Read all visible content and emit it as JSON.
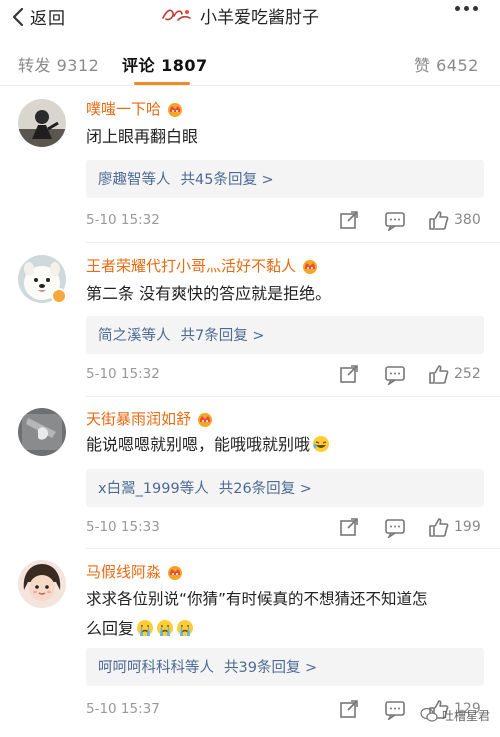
{
  "nav": {
    "back_label": "返回",
    "title": "小羊爱吃酱肘子"
  },
  "tabs": [
    {
      "label": "转发 9312",
      "active": false
    },
    {
      "label": "评论 1807",
      "active": true
    },
    {
      "label": "赞 6452",
      "active": false
    }
  ],
  "colors": {
    "accent": "#f28a1f",
    "username": "#e86b13",
    "reply_link": "#4d6a94",
    "meta_gray": "#999999"
  },
  "comments": [
    {
      "user": "噗嗤一下哈",
      "text": "闭上眼再翻白眼",
      "reply_users": "廖趣智等人",
      "reply_count": "共45条回复 >",
      "time": "5-10 15:32",
      "likes": "380"
    },
    {
      "user": "王者荣耀代打小哥灬活好不黏人",
      "text": "第二条 没有爽快的答应就是拒绝。",
      "reply_users": "简之溪等人",
      "reply_count": "共7条回复 >",
      "time": "5-10 15:32",
      "likes": "252"
    },
    {
      "user": "天街暴雨润如舒",
      "text": "能说嗯嗯就别嗯，能哦哦就别哦",
      "reply_users": "x白翯_1999等人",
      "reply_count": "共26条回复 >",
      "time": "5-10 15:33",
      "likes": "199"
    },
    {
      "user": "马假线阿淼",
      "text_line1": "求求各位别说“你猜”有时候真的不想猜还不知道怎",
      "text_line2": "么回复",
      "reply_users": "呵呵呵科科科等人",
      "reply_count": "共39条回复 >",
      "time": "5-10 15:37",
      "likes": "129"
    }
  ],
  "icons": {
    "back": "chevron-left-icon",
    "more": "more-dots-icon",
    "repost": "repost-icon",
    "comment": "comment-icon",
    "like": "thumbs-up-icon",
    "crown": "crown-badge-icon",
    "verified": "verified-badge-icon"
  },
  "watermark": "吐槽星君"
}
